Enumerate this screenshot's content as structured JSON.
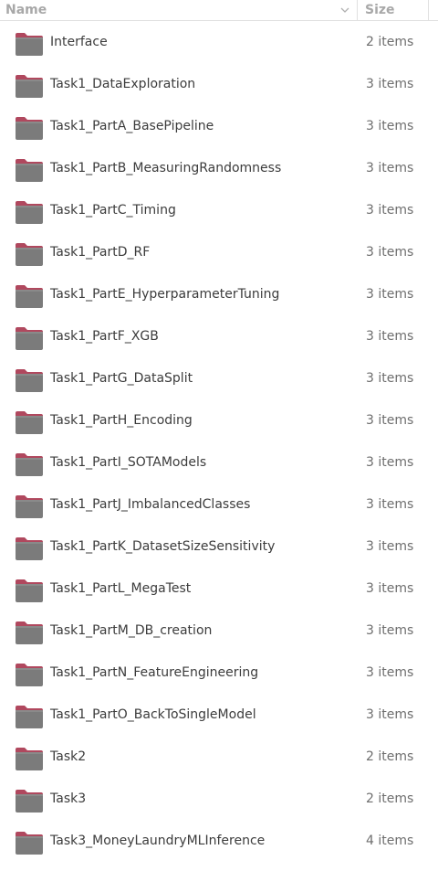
{
  "header": {
    "name_label": "Name",
    "size_label": "Size"
  },
  "files": [
    {
      "name": "Interface",
      "size": "2 items",
      "icon": "folder-icon"
    },
    {
      "name": "Task1_DataExploration",
      "size": "3 items",
      "icon": "folder-icon"
    },
    {
      "name": "Task1_PartA_BasePipeline",
      "size": "3 items",
      "icon": "folder-icon"
    },
    {
      "name": "Task1_PartB_MeasuringRandomness",
      "size": "3 items",
      "icon": "folder-icon"
    },
    {
      "name": "Task1_PartC_Timing",
      "size": "3 items",
      "icon": "folder-icon"
    },
    {
      "name": "Task1_PartD_RF",
      "size": "3 items",
      "icon": "folder-icon"
    },
    {
      "name": "Task1_PartE_HyperparameterTuning",
      "size": "3 items",
      "icon": "folder-icon"
    },
    {
      "name": "Task1_PartF_XGB",
      "size": "3 items",
      "icon": "folder-icon"
    },
    {
      "name": "Task1_PartG_DataSplit",
      "size": "3 items",
      "icon": "folder-icon"
    },
    {
      "name": "Task1_PartH_Encoding",
      "size": "3 items",
      "icon": "folder-icon"
    },
    {
      "name": "Task1_PartI_SOTAModels",
      "size": "3 items",
      "icon": "folder-icon"
    },
    {
      "name": "Task1_PartJ_ImbalancedClasses",
      "size": "3 items",
      "icon": "folder-icon"
    },
    {
      "name": "Task1_PartK_DatasetSizeSensitivity",
      "size": "3 items",
      "icon": "folder-icon"
    },
    {
      "name": "Task1_PartL_MegaTest",
      "size": "3 items",
      "icon": "folder-icon"
    },
    {
      "name": "Task1_PartM_DB_creation",
      "size": "3 items",
      "icon": "folder-icon"
    },
    {
      "name": "Task1_PartN_FeatureEngineering",
      "size": "3 items",
      "icon": "folder-icon"
    },
    {
      "name": "Task1_PartO_BackToSingleModel",
      "size": "3 items",
      "icon": "folder-icon"
    },
    {
      "name": "Task2",
      "size": "2 items",
      "icon": "folder-icon"
    },
    {
      "name": "Task3",
      "size": "2 items",
      "icon": "folder-icon"
    },
    {
      "name": "Task3_MoneyLaundryMLInference",
      "size": "4 items",
      "icon": "folder-icon"
    }
  ],
  "colors": {
    "folder_body": "#7b7b7b",
    "folder_tab": "#b0485e",
    "header_text": "#a8a8a8",
    "text": "#3c3c3c",
    "size_text": "#6e6e6e"
  }
}
